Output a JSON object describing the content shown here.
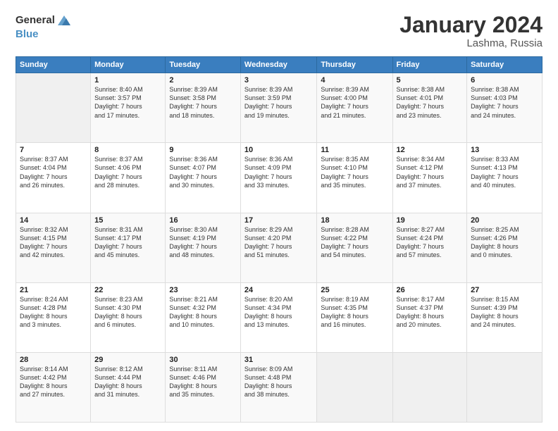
{
  "logo": {
    "general": "General",
    "blue": "Blue"
  },
  "title": "January 2024",
  "location": "Lashma, Russia",
  "days_header": [
    "Sunday",
    "Monday",
    "Tuesday",
    "Wednesday",
    "Thursday",
    "Friday",
    "Saturday"
  ],
  "weeks": [
    [
      {
        "day": "",
        "info": ""
      },
      {
        "day": "1",
        "info": "Sunrise: 8:40 AM\nSunset: 3:57 PM\nDaylight: 7 hours\nand 17 minutes."
      },
      {
        "day": "2",
        "info": "Sunrise: 8:39 AM\nSunset: 3:58 PM\nDaylight: 7 hours\nand 18 minutes."
      },
      {
        "day": "3",
        "info": "Sunrise: 8:39 AM\nSunset: 3:59 PM\nDaylight: 7 hours\nand 19 minutes."
      },
      {
        "day": "4",
        "info": "Sunrise: 8:39 AM\nSunset: 4:00 PM\nDaylight: 7 hours\nand 21 minutes."
      },
      {
        "day": "5",
        "info": "Sunrise: 8:38 AM\nSunset: 4:01 PM\nDaylight: 7 hours\nand 23 minutes."
      },
      {
        "day": "6",
        "info": "Sunrise: 8:38 AM\nSunset: 4:03 PM\nDaylight: 7 hours\nand 24 minutes."
      }
    ],
    [
      {
        "day": "7",
        "info": "Sunrise: 8:37 AM\nSunset: 4:04 PM\nDaylight: 7 hours\nand 26 minutes."
      },
      {
        "day": "8",
        "info": "Sunrise: 8:37 AM\nSunset: 4:06 PM\nDaylight: 7 hours\nand 28 minutes."
      },
      {
        "day": "9",
        "info": "Sunrise: 8:36 AM\nSunset: 4:07 PM\nDaylight: 7 hours\nand 30 minutes."
      },
      {
        "day": "10",
        "info": "Sunrise: 8:36 AM\nSunset: 4:09 PM\nDaylight: 7 hours\nand 33 minutes."
      },
      {
        "day": "11",
        "info": "Sunrise: 8:35 AM\nSunset: 4:10 PM\nDaylight: 7 hours\nand 35 minutes."
      },
      {
        "day": "12",
        "info": "Sunrise: 8:34 AM\nSunset: 4:12 PM\nDaylight: 7 hours\nand 37 minutes."
      },
      {
        "day": "13",
        "info": "Sunrise: 8:33 AM\nSunset: 4:13 PM\nDaylight: 7 hours\nand 40 minutes."
      }
    ],
    [
      {
        "day": "14",
        "info": "Sunrise: 8:32 AM\nSunset: 4:15 PM\nDaylight: 7 hours\nand 42 minutes."
      },
      {
        "day": "15",
        "info": "Sunrise: 8:31 AM\nSunset: 4:17 PM\nDaylight: 7 hours\nand 45 minutes."
      },
      {
        "day": "16",
        "info": "Sunrise: 8:30 AM\nSunset: 4:19 PM\nDaylight: 7 hours\nand 48 minutes."
      },
      {
        "day": "17",
        "info": "Sunrise: 8:29 AM\nSunset: 4:20 PM\nDaylight: 7 hours\nand 51 minutes."
      },
      {
        "day": "18",
        "info": "Sunrise: 8:28 AM\nSunset: 4:22 PM\nDaylight: 7 hours\nand 54 minutes."
      },
      {
        "day": "19",
        "info": "Sunrise: 8:27 AM\nSunset: 4:24 PM\nDaylight: 7 hours\nand 57 minutes."
      },
      {
        "day": "20",
        "info": "Sunrise: 8:25 AM\nSunset: 4:26 PM\nDaylight: 8 hours\nand 0 minutes."
      }
    ],
    [
      {
        "day": "21",
        "info": "Sunrise: 8:24 AM\nSunset: 4:28 PM\nDaylight: 8 hours\nand 3 minutes."
      },
      {
        "day": "22",
        "info": "Sunrise: 8:23 AM\nSunset: 4:30 PM\nDaylight: 8 hours\nand 6 minutes."
      },
      {
        "day": "23",
        "info": "Sunrise: 8:21 AM\nSunset: 4:32 PM\nDaylight: 8 hours\nand 10 minutes."
      },
      {
        "day": "24",
        "info": "Sunrise: 8:20 AM\nSunset: 4:34 PM\nDaylight: 8 hours\nand 13 minutes."
      },
      {
        "day": "25",
        "info": "Sunrise: 8:19 AM\nSunset: 4:35 PM\nDaylight: 8 hours\nand 16 minutes."
      },
      {
        "day": "26",
        "info": "Sunrise: 8:17 AM\nSunset: 4:37 PM\nDaylight: 8 hours\nand 20 minutes."
      },
      {
        "day": "27",
        "info": "Sunrise: 8:15 AM\nSunset: 4:39 PM\nDaylight: 8 hours\nand 24 minutes."
      }
    ],
    [
      {
        "day": "28",
        "info": "Sunrise: 8:14 AM\nSunset: 4:42 PM\nDaylight: 8 hours\nand 27 minutes."
      },
      {
        "day": "29",
        "info": "Sunrise: 8:12 AM\nSunset: 4:44 PM\nDaylight: 8 hours\nand 31 minutes."
      },
      {
        "day": "30",
        "info": "Sunrise: 8:11 AM\nSunset: 4:46 PM\nDaylight: 8 hours\nand 35 minutes."
      },
      {
        "day": "31",
        "info": "Sunrise: 8:09 AM\nSunset: 4:48 PM\nDaylight: 8 hours\nand 38 minutes."
      },
      {
        "day": "",
        "info": ""
      },
      {
        "day": "",
        "info": ""
      },
      {
        "day": "",
        "info": ""
      }
    ]
  ]
}
